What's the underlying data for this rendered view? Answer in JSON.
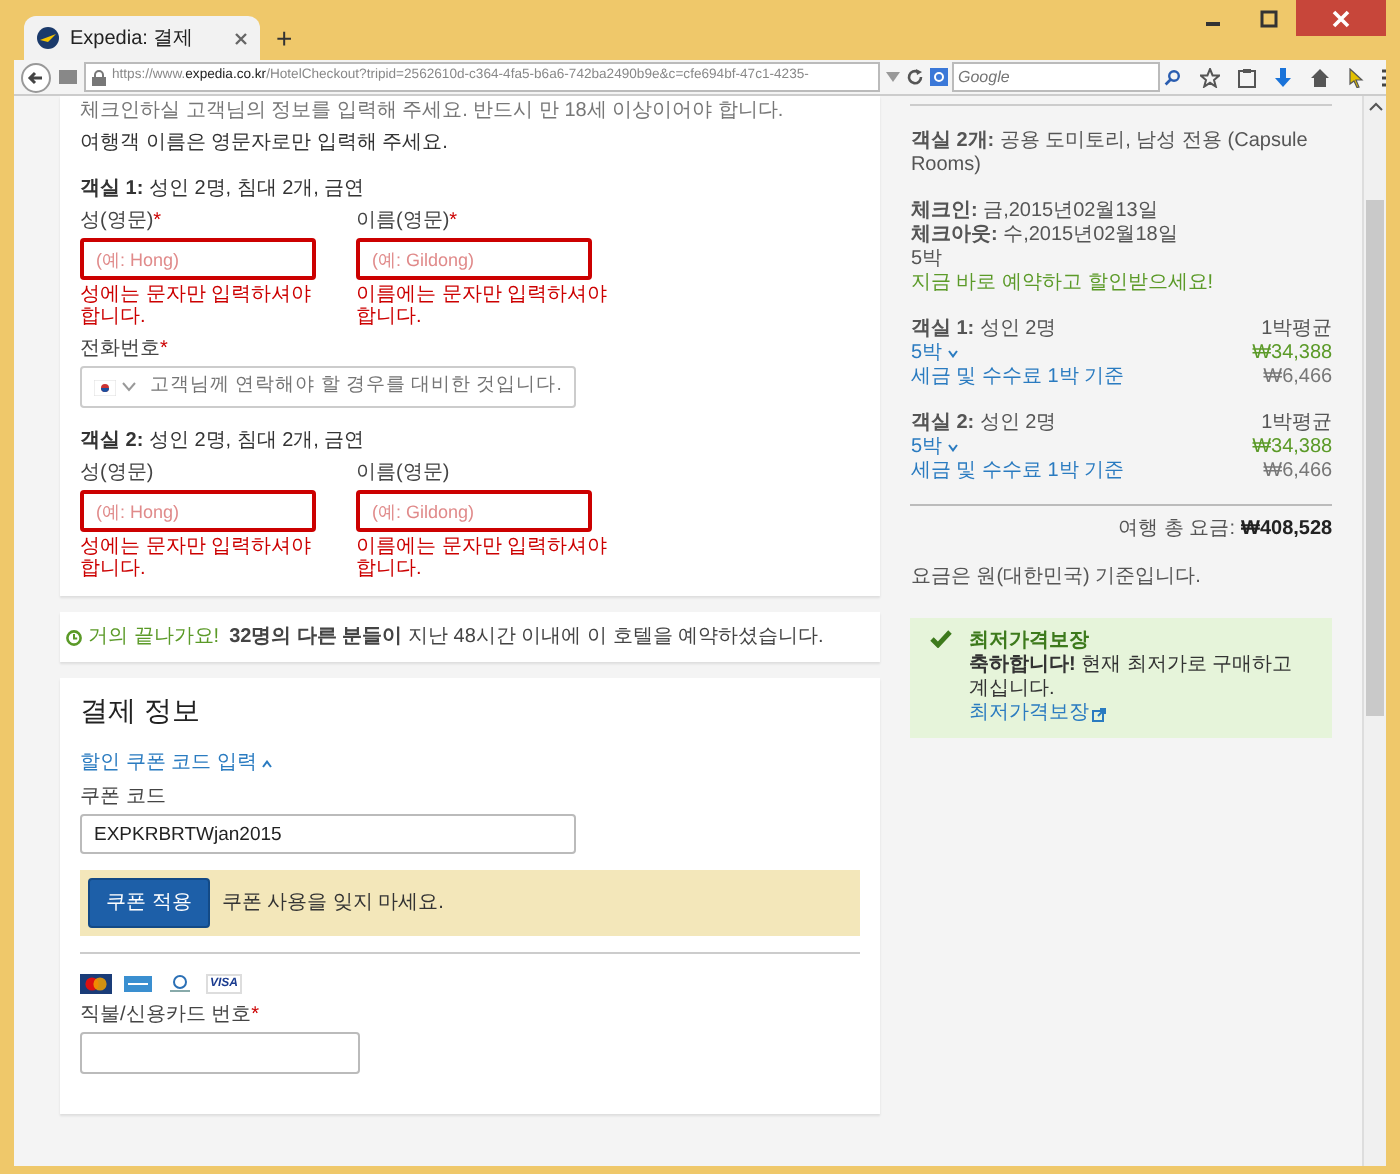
{
  "browser": {
    "tab_title": "Expedia: 결제",
    "new_tab": "+",
    "url_prefix": "https://www.",
    "url_domain": "expedia.co.kr",
    "url_rest": "/HotelCheckout?tripid=2562610d-c364-4fa5-b6a6-742ba2490b9e&c=cfe694bf-47c1-4235-",
    "search_placeholder": "Google"
  },
  "guest_form": {
    "intro": [
      "체크인하실 고객님의 정보를 입력해 주세요. 반드시 만 18세 이상이어야 합니다.",
      "여행객 이름은 영문자로만 입력해 주세요."
    ],
    "rooms": [
      {
        "label": "객실 1:",
        "detail": "성인 2명, 침대 2개, 금연",
        "fields": [
          {
            "label": "성(영문)",
            "required_mark": "*",
            "placeholder": "(예: Hong)",
            "invalid": true,
            "error": "성에는 문자만 입력하셔야 합니다."
          },
          {
            "label": "이름(영문)",
            "required_mark": "*",
            "placeholder": "(예: Gildong)",
            "invalid": true,
            "error": "이름에는 문자만 입력하셔야 합니다."
          }
        ],
        "phone": {
          "label": "전화번호",
          "required_mark": "*",
          "placeholder": "고객님께 연락해야 할 경우를 대비한 것입니다."
        }
      },
      {
        "label": "객실 2:",
        "detail": "성인 2명, 침대 2개, 금연",
        "fields": [
          {
            "label": "성(영문)",
            "placeholder": "(예: Hong)",
            "invalid": true,
            "error": "성에는 문자만 입력하셔야 합니다."
          },
          {
            "label": "이름(영문)",
            "placeholder": "(예: Gildong)",
            "invalid": true,
            "error": "이름에는 문자만 입력하셔야 합니다."
          }
        ]
      }
    ]
  },
  "notice": {
    "highlight": "거의 끝나가요!",
    "text": "**32명의 다른 분들이** 지난 48시간 이내에 이 호텔을 예약하셨습니다."
  },
  "payment": {
    "title": "결제 정보",
    "coupon_toggle": "할인 쿠폰 코드 입력",
    "coupon_label": "쿠폰 코드",
    "coupon_value": "EXPKRBRTWjan2015",
    "apply_button": "쿠폰 적용",
    "coupon_hint": "쿠폰 사용을 잊지 마세요.",
    "cards": [
      {
        "kind": "mastercard"
      },
      {
        "kind": "amex"
      },
      {
        "kind": "diners"
      },
      {
        "kind": "visa",
        "text": "VISA"
      }
    ],
    "card_number": {
      "label": "직불/신용카드 번호",
      "required_mark": "*"
    }
  },
  "summary": {
    "rooms_label": "객실 2개:",
    "rooms_value": "공용 도미토리, 남성 전용 (Capsule Rooms)",
    "dates": [
      {
        "label": "체크인:",
        "value": "금,2015년02월13일"
      },
      {
        "label": "체크아웃:",
        "value": "수,2015년02월18일"
      }
    ],
    "nights": "5박",
    "promo": "지금 바로 예약하고 할인받으세요!",
    "prices": [
      {
        "label": "객실 1:",
        "detail": "성인 2명",
        "avg_label": "1박평균",
        "nights_link": "5박",
        "price": "₩34,388",
        "tax_link": "세금 및 수수료 1박 기준",
        "tax": "₩6,466"
      },
      {
        "label": "객실 2:",
        "detail": "성인 2명",
        "avg_label": "1박평균",
        "nights_link": "5박",
        "price": "₩34,388",
        "tax_link": "세금 및 수수료 1박 기준",
        "tax": "₩6,466"
      }
    ],
    "total_label": "여행 총 요금:",
    "total_value": "₩408,528",
    "currency_note": "요금은 원(대한민국) 기준입니다.",
    "guarantee": {
      "title": "최저가격보장",
      "text": "**축하합니다!** 현재 최저가로 구매하고 계십니다.",
      "link": "최저가격보장"
    }
  }
}
